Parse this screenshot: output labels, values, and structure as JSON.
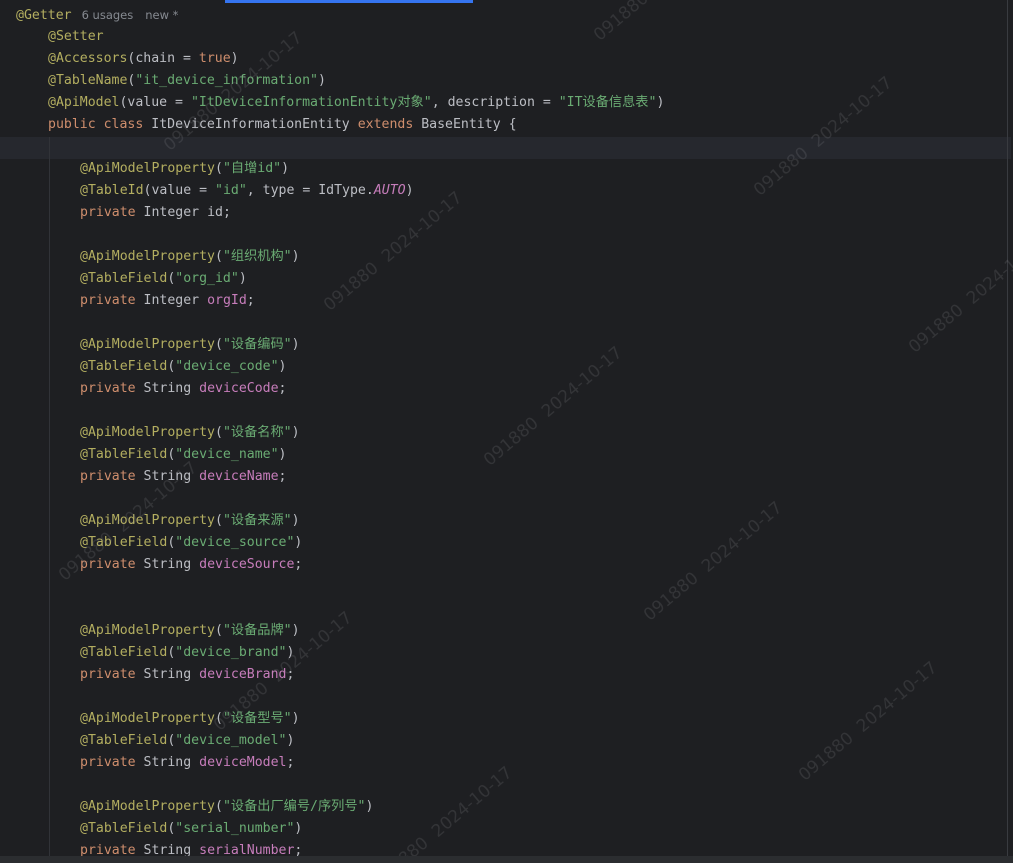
{
  "editor": {
    "inlay_hints": {
      "usages": "6 usages",
      "new_marker": "new *"
    },
    "tokens": {
      "getter": "@Getter",
      "setter": "@Setter",
      "accessors": "@Accessors",
      "chain_param": "(chain = ",
      "true_kw": "true",
      "close_paren": ")",
      "table_name": "@TableName",
      "open_paren": "(",
      "table_name_value": "\"it_device_information\"",
      "api_model": "@ApiModel",
      "value_eq": "(value = ",
      "api_model_value": "\"ItDeviceInformationEntity对象\"",
      "description_eq": ", description = ",
      "api_model_desc": "\"IT设备信息表\"",
      "public_kw": "public",
      "class_kw": "class",
      "class_name": "ItDeviceInformationEntity",
      "extends_kw": "extends",
      "base_class": "BaseEntity {",
      "api_model_property": "@ApiModelProperty",
      "table_id": "@TableId",
      "table_field": "@TableField",
      "id_value": "\"id\"",
      "type_eq": ", type = IdType.",
      "auto_const": "AUTO",
      "private_kw": "private",
      "integer_type": "Integer",
      "string_type": "String",
      "semicolon": ";"
    },
    "fields": [
      {
        "label": "\"自增id\"",
        "column": "\"id\"",
        "type": "Integer",
        "name": "id"
      },
      {
        "label": "\"组织机构\"",
        "column": "\"org_id\"",
        "type": "Integer",
        "name": "orgId"
      },
      {
        "label": "\"设备编码\"",
        "column": "\"device_code\"",
        "type": "String",
        "name": "deviceCode"
      },
      {
        "label": "\"设备名称\"",
        "column": "\"device_name\"",
        "type": "String",
        "name": "deviceName"
      },
      {
        "label": "\"设备来源\"",
        "column": "\"device_source\"",
        "type": "String",
        "name": "deviceSource"
      },
      {
        "label": "\"设备品牌\"",
        "column": "\"device_brand\"",
        "type": "String",
        "name": "deviceBrand"
      },
      {
        "label": "\"设备型号\"",
        "column": "\"device_model\"",
        "type": "String",
        "name": "deviceModel"
      },
      {
        "label": "\"设备出厂编号/序列号\"",
        "column": "\"serial_number\"",
        "type": "String",
        "name": "serialNumber"
      }
    ],
    "watermark_text": "091880  2024-10-17"
  },
  "colors": {
    "background": "#1e1f22",
    "annotation": "#b3ae60",
    "keyword": "#cf8e6d",
    "string": "#6aab73",
    "field": "#c77dbb",
    "default_text": "#bcbec4",
    "accent": "#3574f0"
  }
}
